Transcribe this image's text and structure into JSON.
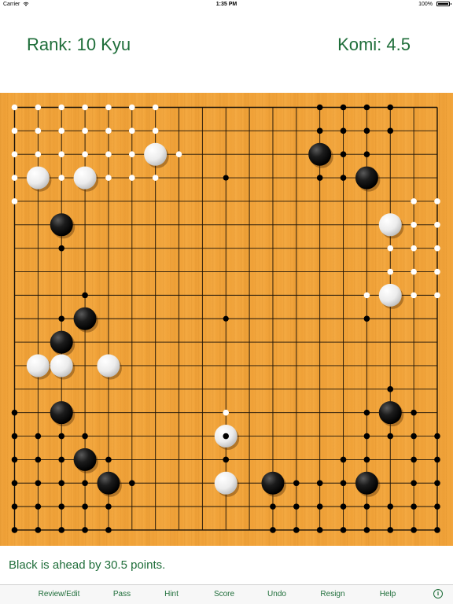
{
  "status_bar": {
    "carrier": "Carrier",
    "time": "1:35 PM",
    "battery": "100%"
  },
  "header": {
    "rank": "Rank: 10 Kyu",
    "komi": "Komi: 4.5"
  },
  "board": {
    "size": 19,
    "star_points": [
      [
        3,
        3
      ],
      [
        3,
        9
      ],
      [
        3,
        15
      ],
      [
        9,
        3
      ],
      [
        9,
        9
      ],
      [
        9,
        15
      ],
      [
        15,
        3
      ],
      [
        15,
        9
      ],
      [
        15,
        15
      ]
    ],
    "black_stones": [
      [
        13,
        2
      ],
      [
        15,
        3
      ],
      [
        2,
        5
      ],
      [
        3,
        9
      ],
      [
        2,
        10
      ],
      [
        2,
        13
      ],
      [
        3,
        15
      ],
      [
        4,
        16
      ],
      [
        11,
        16
      ],
      [
        15,
        16
      ],
      [
        16,
        13
      ]
    ],
    "white_stones": [
      [
        1,
        3
      ],
      [
        3,
        3
      ],
      [
        6,
        2
      ],
      [
        16,
        5
      ],
      [
        16,
        8
      ],
      [
        1,
        11
      ],
      [
        2,
        11
      ],
      [
        4,
        11
      ],
      [
        9,
        14
      ],
      [
        9,
        16
      ]
    ],
    "last_move": [
      9,
      14
    ],
    "black_territory": [
      [
        13,
        0
      ],
      [
        14,
        0
      ],
      [
        15,
        0
      ],
      [
        16,
        0
      ],
      [
        13,
        1
      ],
      [
        14,
        1
      ],
      [
        15,
        1
      ],
      [
        16,
        1
      ],
      [
        14,
        2
      ],
      [
        15,
        2
      ],
      [
        13,
        3
      ],
      [
        14,
        3
      ],
      [
        2,
        6
      ],
      [
        3,
        8
      ],
      [
        2,
        9
      ],
      [
        15,
        9
      ],
      [
        16,
        12
      ],
      [
        0,
        13
      ],
      [
        15,
        13
      ],
      [
        17,
        13
      ],
      [
        0,
        14
      ],
      [
        1,
        14
      ],
      [
        2,
        14
      ],
      [
        3,
        14
      ],
      [
        15,
        14
      ],
      [
        16,
        14
      ],
      [
        17,
        14
      ],
      [
        18,
        14
      ],
      [
        0,
        15
      ],
      [
        1,
        15
      ],
      [
        2,
        15
      ],
      [
        4,
        15
      ],
      [
        14,
        15
      ],
      [
        15,
        15
      ],
      [
        17,
        15
      ],
      [
        18,
        15
      ],
      [
        0,
        16
      ],
      [
        1,
        16
      ],
      [
        2,
        16
      ],
      [
        3,
        16
      ],
      [
        5,
        16
      ],
      [
        12,
        16
      ],
      [
        13,
        16
      ],
      [
        14,
        16
      ],
      [
        17,
        16
      ],
      [
        18,
        16
      ],
      [
        0,
        17
      ],
      [
        1,
        17
      ],
      [
        2,
        17
      ],
      [
        3,
        17
      ],
      [
        4,
        17
      ],
      [
        11,
        17
      ],
      [
        12,
        17
      ],
      [
        13,
        17
      ],
      [
        14,
        17
      ],
      [
        15,
        17
      ],
      [
        16,
        17
      ],
      [
        17,
        17
      ],
      [
        18,
        17
      ],
      [
        0,
        18
      ],
      [
        1,
        18
      ],
      [
        2,
        18
      ],
      [
        3,
        18
      ],
      [
        4,
        18
      ],
      [
        11,
        18
      ],
      [
        12,
        18
      ],
      [
        13,
        18
      ],
      [
        14,
        18
      ],
      [
        15,
        18
      ],
      [
        16,
        18
      ],
      [
        17,
        18
      ],
      [
        18,
        18
      ],
      [
        9,
        15
      ]
    ],
    "white_territory": [
      [
        0,
        0
      ],
      [
        1,
        0
      ],
      [
        2,
        0
      ],
      [
        3,
        0
      ],
      [
        4,
        0
      ],
      [
        5,
        0
      ],
      [
        6,
        0
      ],
      [
        0,
        1
      ],
      [
        1,
        1
      ],
      [
        2,
        1
      ],
      [
        3,
        1
      ],
      [
        4,
        1
      ],
      [
        5,
        1
      ],
      [
        6,
        1
      ],
      [
        0,
        2
      ],
      [
        1,
        2
      ],
      [
        2,
        2
      ],
      [
        3,
        2
      ],
      [
        4,
        2
      ],
      [
        5,
        2
      ],
      [
        7,
        2
      ],
      [
        0,
        3
      ],
      [
        2,
        3
      ],
      [
        4,
        3
      ],
      [
        5,
        3
      ],
      [
        6,
        3
      ],
      [
        0,
        4
      ],
      [
        17,
        4
      ],
      [
        18,
        4
      ],
      [
        17,
        5
      ],
      [
        18,
        5
      ],
      [
        16,
        6
      ],
      [
        17,
        6
      ],
      [
        18,
        6
      ],
      [
        16,
        7
      ],
      [
        17,
        7
      ],
      [
        18,
        7
      ],
      [
        15,
        8
      ],
      [
        17,
        8
      ],
      [
        18,
        8
      ],
      [
        9,
        13
      ]
    ]
  },
  "message": "Black is ahead by 30.5 points.",
  "toolbar": {
    "review_edit": "Review/Edit",
    "pass": "Pass",
    "hint": "Hint",
    "score": "Score",
    "undo": "Undo",
    "resign": "Resign",
    "help": "Help",
    "info_icon": "info-icon"
  },
  "colors": {
    "accent_green": "#1f6e3a",
    "board_wood": "#f2a43a",
    "grid_line": "#1a1208"
  }
}
